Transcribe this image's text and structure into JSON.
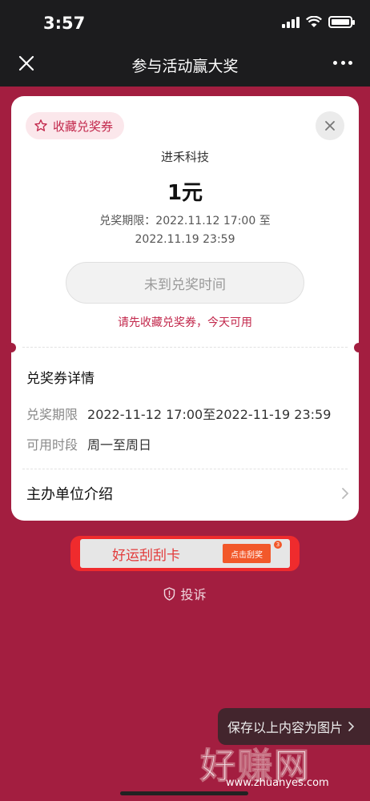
{
  "status_bar": {
    "time": "3:57"
  },
  "nav": {
    "title": "参与活动赢大奖"
  },
  "coupon": {
    "collect_tag": "收藏兑奖券",
    "merchant": "进禾科技",
    "amount": "1元",
    "validity_line1": "兑奖期限：2022.11.12 17:00 至",
    "validity_line2": "2022.11.19 23:59",
    "redeem_button": "未到兑奖时间",
    "hint": "请先收藏兑奖券，今天可用"
  },
  "details": {
    "title": "兑奖券详情",
    "rows": [
      {
        "label": "兑奖期限",
        "value": "2022-11-12 17:00至2022-11-19 23:59"
      },
      {
        "label": "可用时段",
        "value": "周一至周日"
      }
    ],
    "organizer_label": "主办单位介绍"
  },
  "scratch_banner": {
    "text": "好运刮刮卡",
    "button": "点击刮奖",
    "badge": "3"
  },
  "complain": {
    "label": "投诉"
  },
  "save_image": {
    "label": "保存以上内容为图片"
  },
  "watermark": {
    "big": "好赚网",
    "small": "www.zhuanyes.com"
  },
  "colors": {
    "background": "#a31e40",
    "accent": "#c2274b",
    "scratch": "#ef2b2d"
  }
}
